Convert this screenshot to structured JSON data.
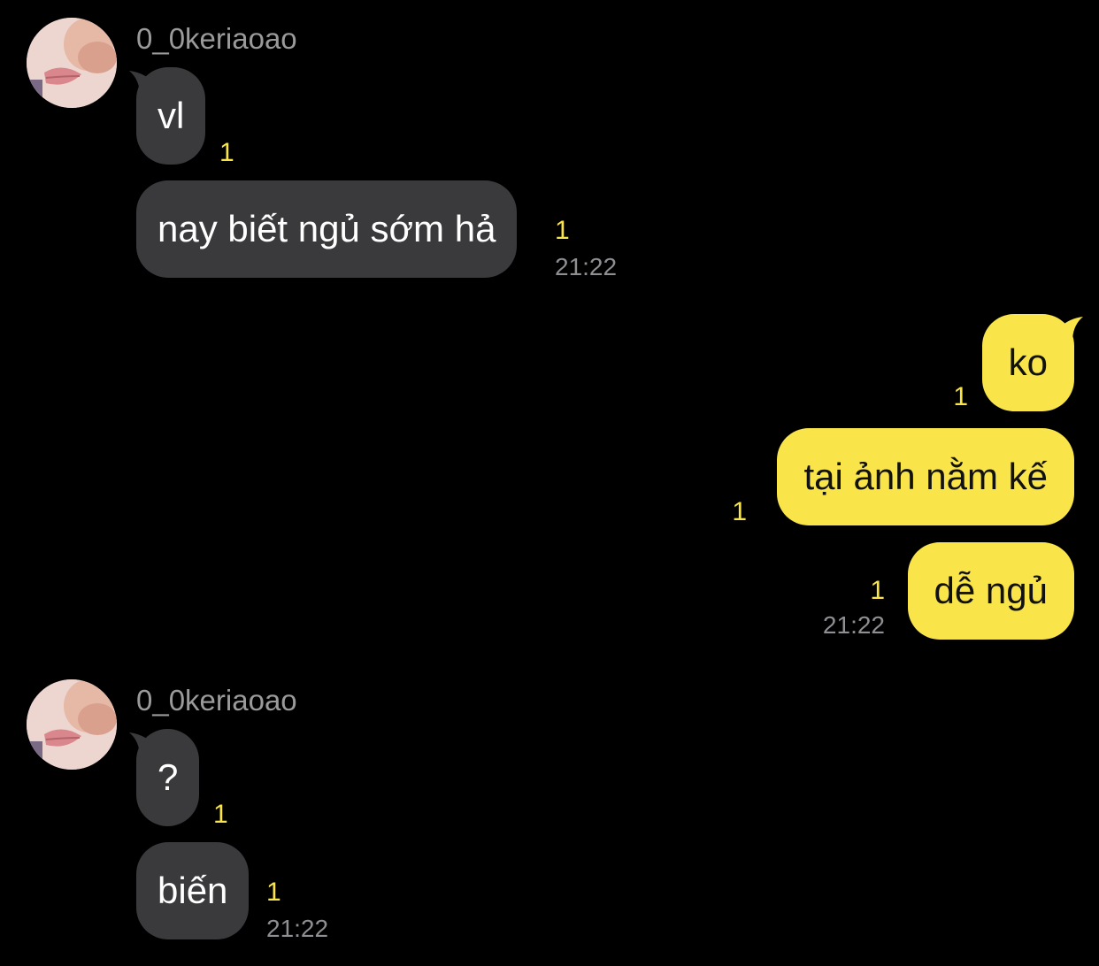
{
  "colors": {
    "background": "#000000",
    "incoming_bubble": "#3a3a3c",
    "outgoing_bubble": "#f9e54a",
    "unread_count": "#f9e54a",
    "timestamp": "#8e8e93",
    "username": "#9a9a9a"
  },
  "groups": [
    {
      "sender": "0_0keriaoao",
      "avatar_icon": "profile-photo-avatar",
      "messages": [
        {
          "text": "vl",
          "unread": "1"
        },
        {
          "text": "nay biết ngủ sớm hả",
          "unread": "1",
          "time": "21:22"
        }
      ]
    },
    {
      "sender": "me",
      "messages": [
        {
          "text": "ko",
          "unread": "1"
        },
        {
          "text": "tại ảnh nằm kế",
          "unread": "1"
        },
        {
          "text": "dễ ngủ",
          "unread": "1",
          "time": "21:22"
        }
      ]
    },
    {
      "sender": "0_0keriaoao",
      "avatar_icon": "profile-photo-avatar",
      "messages": [
        {
          "text": "?",
          "unread": "1"
        },
        {
          "text": "biến",
          "unread": "1",
          "time": "21:22"
        }
      ]
    }
  ]
}
